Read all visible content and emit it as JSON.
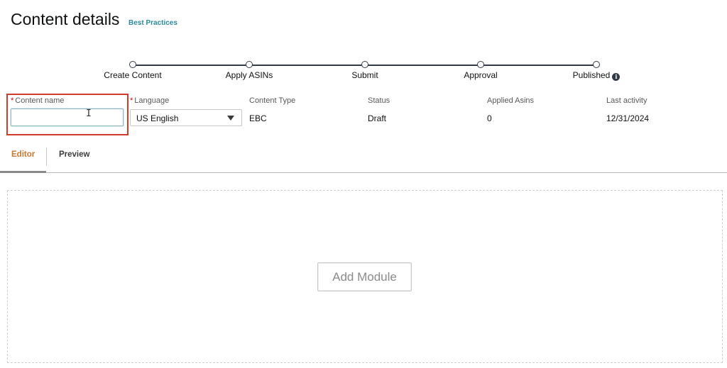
{
  "header": {
    "title": "Content details",
    "best_practices_link": "Best Practices"
  },
  "steps": [
    {
      "label": "Create Content"
    },
    {
      "label": "Apply ASINs"
    },
    {
      "label": "Submit"
    },
    {
      "label": "Approval"
    },
    {
      "label": "Published",
      "info_icon": "info-icon"
    }
  ],
  "fields": {
    "required_marker": "*",
    "content_name": {
      "label": "Content name",
      "value": ""
    },
    "language": {
      "label": "Language",
      "value": "US English"
    },
    "content_type": {
      "label": "Content Type",
      "value": "EBC"
    },
    "status": {
      "label": "Status",
      "value": "Draft"
    },
    "applied_asins": {
      "label": "Applied Asins",
      "value": "0"
    },
    "last_activity": {
      "label": "Last activity",
      "value": "12/31/2024"
    }
  },
  "tabs": [
    {
      "label": "Editor",
      "active": true
    },
    {
      "label": "Preview",
      "active": false
    }
  ],
  "editor": {
    "add_module_label": "Add Module"
  },
  "colors": {
    "active_tab": "#c7782f",
    "link": "#2b8a9a",
    "highlight": "#d13b2a"
  }
}
